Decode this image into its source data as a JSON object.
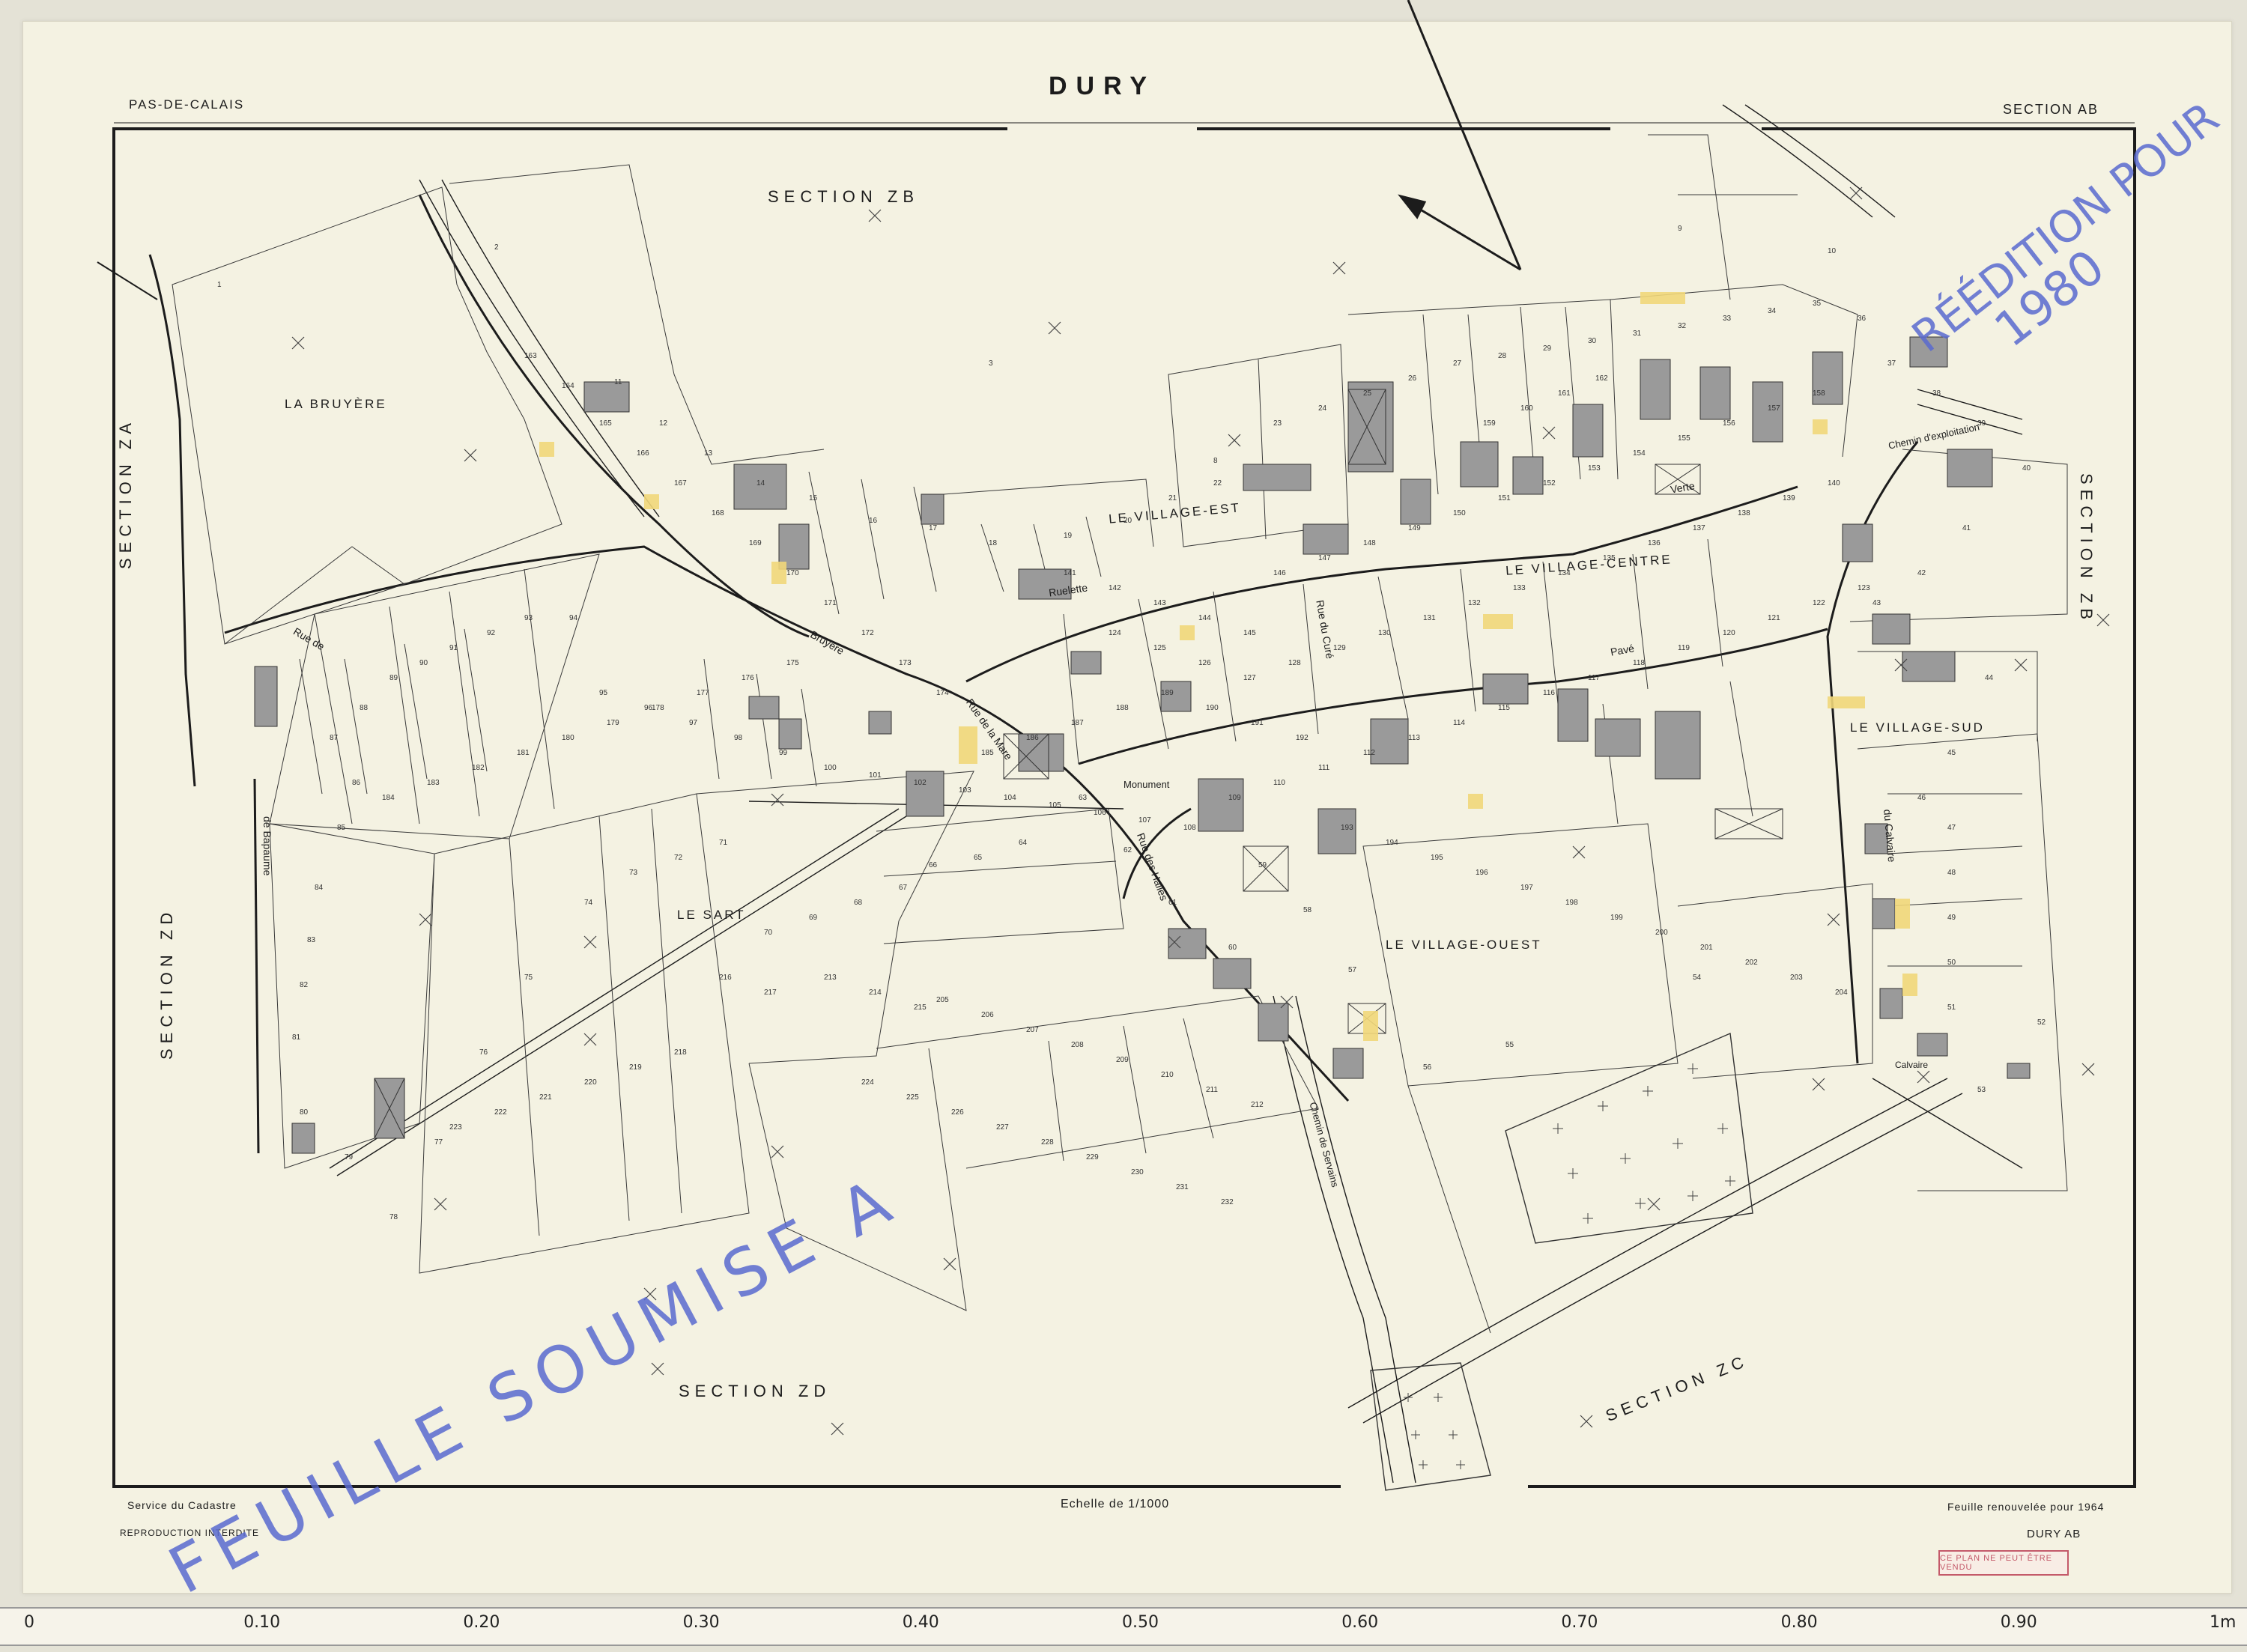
{
  "header": {
    "title": "DURY",
    "department": "PAS-DE-CALAIS",
    "section_id": "SECTION AB"
  },
  "sections": {
    "zb_top": "SECTION ZB",
    "za_left": "SECTION ZA",
    "zd_left": "SECTION ZD",
    "zb_right": "SECTION ZB",
    "zd_bottom": "SECTION ZD",
    "zc_bottom": "SECTION ZC"
  },
  "localities": {
    "bruyere": "LA BRUYÈRE",
    "village_est": "LE VILLAGE-EST",
    "village_centre": "LE VILLAGE-CENTRE",
    "village_sud": "LE VILLAGE-SUD",
    "sart": "LE SART",
    "village_ouest": "LE VILLAGE-OUEST"
  },
  "streets": {
    "rue_bruyere": "Bruyère",
    "rue_de": "Rue de",
    "rue_mare": "Rue de la Mare",
    "ruelette": "Ruelette",
    "rue_verte": "Verte",
    "rue_pave": "Pavé",
    "rue_cure": "Rue du Curé",
    "rue_halles": "Rue des Halles",
    "rue_calvaire": "du Calvaire",
    "route_bapaume": "de Bapaume",
    "chemin_exploitation": "Chemin d'exploitation",
    "chemin_servains": "Chemin de Servains",
    "monument": "Monument",
    "calvaire": "Calvaire"
  },
  "footer": {
    "service": "Service du Cadastre",
    "reproduction": "REPRODUCTION INTERDITE",
    "scale": "Echelle de 1/1000",
    "renewed": "Feuille renouvelée pour 1964",
    "sheet_ref": "DURY AB",
    "stamp": "CE PLAN NE PEUT ÊTRE VENDU"
  },
  "annotations": {
    "reedition": "RÉÉDITION POUR",
    "year": "1980",
    "feuille": "FEUILLE SOUMISE A"
  },
  "parcels": [
    "1",
    "2",
    "3",
    "8",
    "9",
    "10",
    "11",
    "12",
    "13",
    "14",
    "15",
    "16",
    "17",
    "18",
    "19",
    "20",
    "21",
    "22",
    "23",
    "24",
    "25",
    "26",
    "27",
    "28",
    "29",
    "30",
    "31",
    "32",
    "33",
    "34",
    "35",
    "36",
    "37",
    "38",
    "39",
    "40",
    "41",
    "42",
    "43",
    "44",
    "45",
    "46",
    "47",
    "48",
    "49",
    "50",
    "51",
    "52",
    "53",
    "54",
    "55",
    "56",
    "57",
    "58",
    "59",
    "60",
    "61",
    "62",
    "63",
    "64",
    "65",
    "66",
    "67",
    "68",
    "69",
    "70",
    "71",
    "72",
    "73",
    "74",
    "75",
    "76",
    "77",
    "78",
    "79",
    "80",
    "81",
    "82",
    "83",
    "84",
    "85",
    "86",
    "87",
    "88",
    "89",
    "90",
    "91",
    "92",
    "93",
    "94",
    "95",
    "96",
    "97",
    "98",
    "99",
    "100",
    "101",
    "102",
    "103",
    "104",
    "105",
    "106",
    "107",
    "108",
    "109",
    "110",
    "111",
    "112",
    "113",
    "114",
    "115",
    "116",
    "117",
    "118",
    "119",
    "120",
    "121",
    "122",
    "123",
    "124",
    "125",
    "126",
    "127",
    "128",
    "129",
    "130",
    "131",
    "132",
    "133",
    "134",
    "135",
    "136",
    "137",
    "138",
    "139",
    "140",
    "141",
    "142",
    "143",
    "144",
    "145",
    "146",
    "147",
    "148",
    "149",
    "150",
    "151",
    "152",
    "153",
    "154",
    "155",
    "156",
    "157",
    "158",
    "159",
    "160",
    "161",
    "162",
    "163",
    "164",
    "165",
    "166",
    "167",
    "168",
    "169",
    "170",
    "171",
    "172",
    "173",
    "174",
    "175",
    "176",
    "177",
    "178",
    "179",
    "180",
    "181",
    "182",
    "183",
    "184",
    "185",
    "186",
    "187",
    "188",
    "189",
    "190",
    "191",
    "192",
    "193",
    "194",
    "195",
    "196",
    "197",
    "198",
    "199",
    "200",
    "201",
    "202",
    "203",
    "204",
    "205",
    "206",
    "207",
    "208",
    "209",
    "210",
    "211",
    "212",
    "213",
    "214",
    "215",
    "216",
    "217",
    "218",
    "219",
    "220",
    "221",
    "222",
    "223",
    "224",
    "225",
    "226",
    "227",
    "228",
    "229",
    "230",
    "231",
    "232"
  ],
  "ruler": [
    "0",
    "0.10",
    "0.20",
    "0.30",
    "0.40",
    "0.50",
    "0.60",
    "0.70",
    "0.80",
    "0.90",
    "1m"
  ],
  "colors": {
    "paper": "#f4f2e2",
    "ink": "#1c1c1c",
    "building": "#9a9a9a",
    "highlight": "#f1d77a",
    "annotation": "#5a6ad0",
    "stamp": "#c45a6a"
  }
}
